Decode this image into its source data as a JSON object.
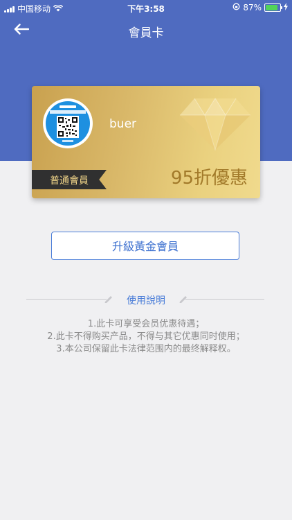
{
  "status_bar": {
    "carrier": "中国移动",
    "time": "下午3:58",
    "battery": "87%"
  },
  "nav": {
    "title": "會員卡"
  },
  "card": {
    "name": "buer",
    "level": "普通會員",
    "discount": "95折優惠"
  },
  "upgrade_button": "升級黃金會員",
  "usage": {
    "title": "使用說明",
    "rules": [
      "1.此卡可享受会员优惠待遇；",
      "2.此卡不得购买产品，不得与其它优惠同时使用；",
      "3.本公司保留此卡法律范围内的最终解释权。"
    ]
  },
  "colors": {
    "header": "#4f6bc0",
    "accent": "#4a7dd8",
    "card_gold": "#d9b869",
    "background": "#f0f0f2"
  },
  "icons": {
    "back": "back-arrow-icon",
    "diamond": "diamond-icon",
    "pencil": "pencil-icon",
    "wifi": "wifi-icon",
    "battery": "battery-icon"
  }
}
